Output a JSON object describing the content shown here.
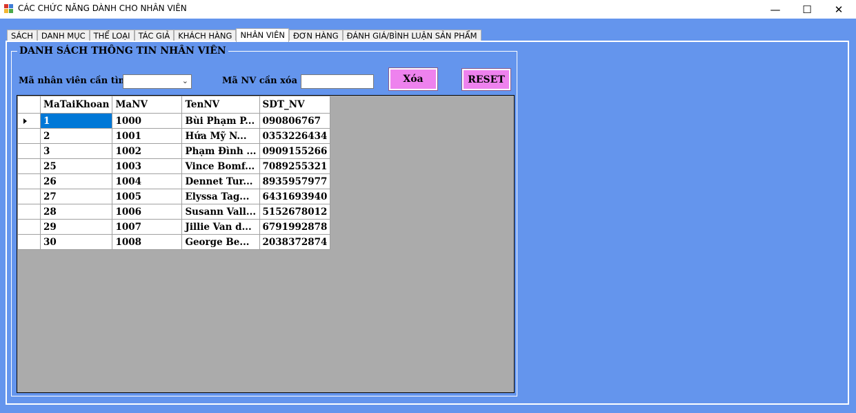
{
  "window": {
    "title": "CÁC CHỨC NĂNG DÀNH CHO NHÂN VIÊN",
    "minimize": "—",
    "maximize": "☐",
    "close": "✕"
  },
  "tabs": [
    {
      "label": "SÁCH"
    },
    {
      "label": "DANH MỤC"
    },
    {
      "label": "THỂ LOẠI"
    },
    {
      "label": "TÁC GIẢ"
    },
    {
      "label": "KHÁCH HÀNG"
    },
    {
      "label": "NHÂN VIÊN"
    },
    {
      "label": "ĐƠN HÀNG"
    },
    {
      "label": "ĐÁNH GIÁ/BÌNH LUẬN SẢN PHẨM"
    }
  ],
  "group": {
    "title": "DANH SÁCH THÔNG TIN NHÂN VIÊN"
  },
  "search": {
    "label": "Mã nhân viên cần tìm",
    "value": ""
  },
  "delete": {
    "label": "Mã NV cần xóa",
    "value": "",
    "button": "Xóa"
  },
  "reset": {
    "button": "RESET"
  },
  "grid": {
    "columns": [
      "MaTaiKhoan",
      "MaNV",
      "TenNV",
      "SDT_NV"
    ],
    "rows": [
      [
        "1",
        "1000",
        "Bùi Phạm P...",
        "090806767"
      ],
      [
        "2",
        "1001",
        "Hứa Mỹ N...",
        "0353226434"
      ],
      [
        "3",
        "1002",
        "Phạm Đình ...",
        "0909155266"
      ],
      [
        "25",
        "1003",
        "Vince Bomf...",
        "7089255321"
      ],
      [
        "26",
        "1004",
        "Dennet Tur...",
        "8935957977"
      ],
      [
        "27",
        "1005",
        "Elyssa Tag...",
        "6431693940"
      ],
      [
        "28",
        "1006",
        "Susann Vall...",
        "5152678012"
      ],
      [
        "29",
        "1007",
        "Jillie Van d...",
        "6791992878"
      ],
      [
        "30",
        "1008",
        "George Be...",
        "2038372874"
      ]
    ],
    "selected_row": 0
  },
  "colors": {
    "background": "#6495ED",
    "button": "#EE82EE",
    "grid_background": "#ABABAB",
    "selection": "#0078D7"
  }
}
